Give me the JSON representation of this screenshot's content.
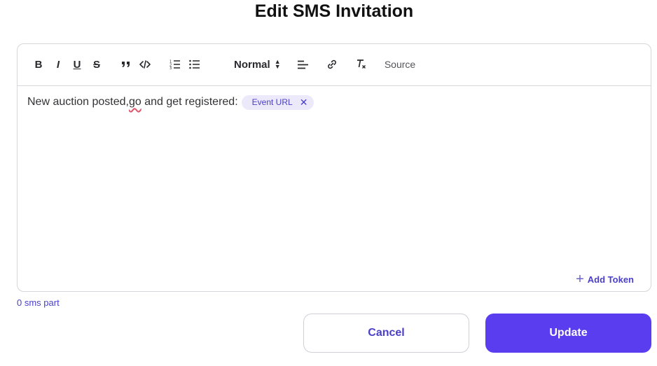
{
  "dialog": {
    "title": "Edit SMS Invitation"
  },
  "toolbar": {
    "bold": "B",
    "italic": "I",
    "underline": "U",
    "strike": "S",
    "format_select": "Normal",
    "source": "Source"
  },
  "editor": {
    "text_before": "New auction posted, ",
    "misspelled_word": "go",
    "text_after": " and get registered:",
    "token_chip": "Event URL",
    "token_remove": "✕",
    "add_token_label": "Add Token"
  },
  "status": {
    "sms_parts": "0 sms part"
  },
  "actions": {
    "cancel_label": "Cancel",
    "update_label": "Update"
  },
  "colors": {
    "accent": "#5b3df0",
    "chip_bg": "#ece9fb",
    "chip_text": "#4a3fc6"
  }
}
